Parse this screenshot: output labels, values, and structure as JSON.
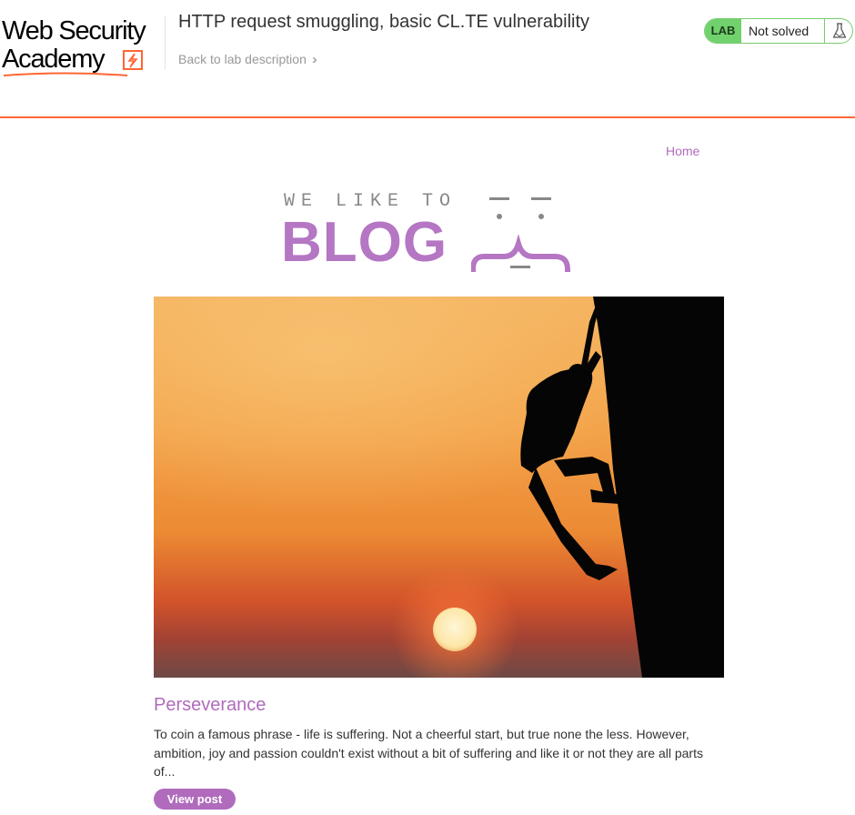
{
  "academy": {
    "logo_line1": "Web Security",
    "logo_line2": "Academy",
    "lab_title": "HTTP request smuggling, basic CL.TE vulnerability",
    "back_link": "Back to lab description",
    "lab_badge": "LAB",
    "lab_status": "Not solved",
    "icons": {
      "back": "double-chevron-right-icon",
      "lab": "flask-icon",
      "logo": "lightning-bolt-icon"
    },
    "colors": {
      "accent": "#ff6633",
      "solved_green": "#70d16d"
    }
  },
  "blog": {
    "nav": {
      "home": "Home"
    },
    "logo": {
      "tagline": "WE LIKE TO",
      "word": "BLOG"
    },
    "hero_image": "silhouette-climber-sunset",
    "post": {
      "title": "Perseverance",
      "summary": "To coin a famous phrase - life is suffering. Not a cheerful start, but true none the less. However, ambition, joy and passion couldn't exist without a bit of suffering and like it or not they are all parts of...",
      "button": "View post"
    },
    "colors": {
      "accent": "#b06bbd"
    }
  }
}
